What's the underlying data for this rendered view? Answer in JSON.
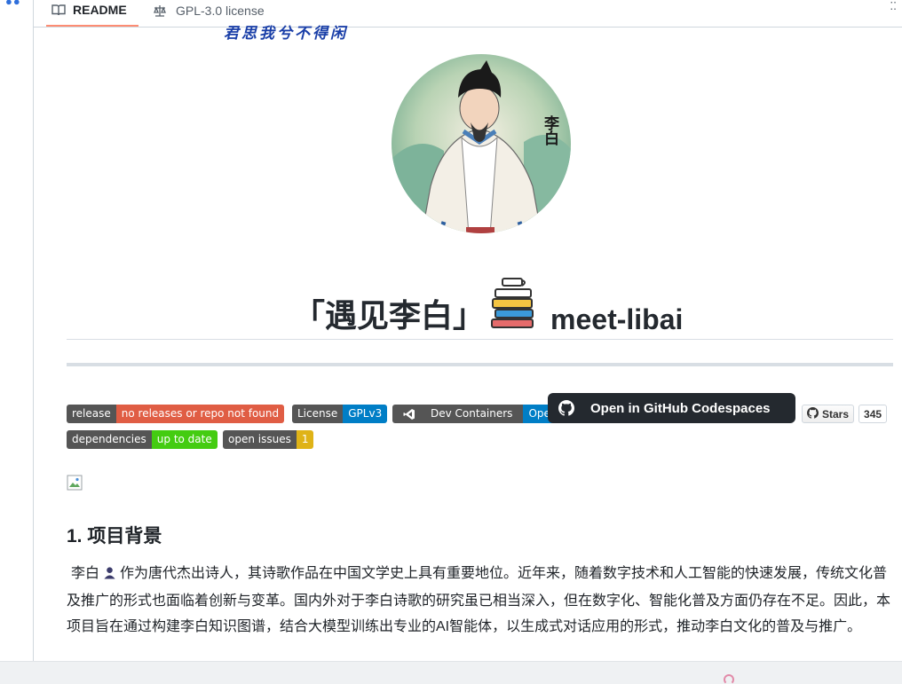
{
  "tabs": [
    {
      "label": "README",
      "icon": "book-icon",
      "active": true
    },
    {
      "label": "GPL-3.0 license",
      "icon": "scale-icon",
      "active": false
    }
  ],
  "calligraphy_text": "君思我兮不得闲",
  "portrait": {
    "label": "李白"
  },
  "title": {
    "cn": "「遇见李白」",
    "en": "meet-libai",
    "icon": "books-icon"
  },
  "badges": [
    {
      "key": "release",
      "value": "no releases or repo not found",
      "color": "#e05d44"
    },
    {
      "key": "License",
      "value": "GPLv3",
      "color": "#007ec6"
    },
    {
      "key": "Dev Containers",
      "value": "Open",
      "color": "#007ec6",
      "icon": "vscode-icon"
    },
    {
      "key": "dependencies",
      "value": "up to date",
      "color": "#44cc11"
    },
    {
      "key": "open issues",
      "value": "1",
      "color": "#dfb317"
    }
  ],
  "codespaces_button": {
    "label": "Open in GitHub Codespaces"
  },
  "stars": {
    "label": "Stars",
    "count": "345"
  },
  "section": {
    "heading": "1. 项目背景",
    "paragraph_start": "李白",
    "paragraph_rest": "作为唐代杰出诗人，其诗歌作品在中国文学史上具有重要地位。近年来，随着数字技术和人工智能的快速发展，传统文化普及推广的形式也面临着创新与变革。国内外对于李白诗歌的研究虽已相当深入，但在数字化、智能化普及方面仍存在不足。因此，本项目旨在通过构建李白知识图谱，结合大模型训练出专业的AI智能体，以生成式对话应用的形式，推动李白文化的普及与推广。"
  }
}
